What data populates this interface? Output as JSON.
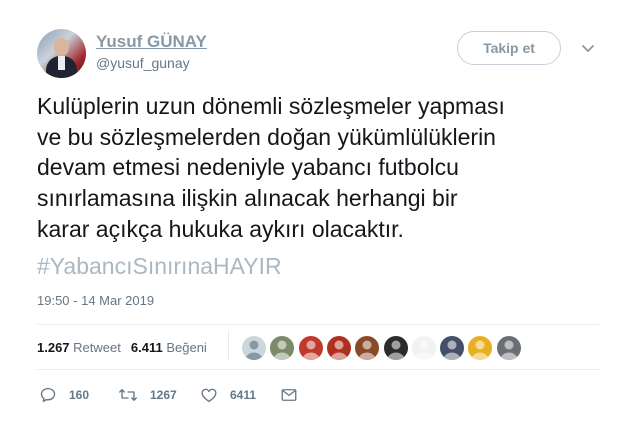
{
  "author": {
    "name": "Yusuf GÜNAY",
    "handle": "@yusuf_gunay"
  },
  "follow_label": "Takip et",
  "tweet": {
    "lines": [
      "Kulüplerin uzun dönemli sözleşmeler yapması",
      "ve bu sözleşmelerden doğan yükümlülüklerin",
      "devam etmesi nedeniyle yabancı futbolcu",
      "sınırlamasına ilişkin alınacak herhangi bir",
      "karar açıkça hukuka aykırı olacaktır."
    ],
    "hashtag": "#YabancıSınırınaHAYIR",
    "timestamp": "19:50 - 14 Mar 2019"
  },
  "stats": {
    "retweets_count": "1.267",
    "retweets_label": "Retweet",
    "likes_count": "6.411",
    "likes_label": "Beğeni"
  },
  "likers": [
    {
      "icon": "default-avatar-icon",
      "color": "#ccd6dd"
    },
    {
      "icon": "user-avatar-icon",
      "color": "#7a8a6a"
    },
    {
      "icon": "user-avatar-icon",
      "color": "#c0392b"
    },
    {
      "icon": "user-avatar-icon",
      "color": "#b03020"
    },
    {
      "icon": "user-avatar-icon",
      "color": "#8a4a2a"
    },
    {
      "icon": "user-avatar-icon",
      "color": "#2b2b2b"
    },
    {
      "icon": "user-avatar-icon",
      "color": "#f2f2f2"
    },
    {
      "icon": "user-avatar-icon",
      "color": "#44506a"
    },
    {
      "icon": "user-avatar-icon",
      "color": "#e8b020"
    },
    {
      "icon": "user-avatar-icon",
      "color": "#6b6f75"
    }
  ],
  "actions": {
    "replies": "160",
    "retweets": "1267",
    "likes": "6411"
  },
  "colors": {
    "text": "#14171a",
    "muted": "#657786",
    "hashtag": "#aab8c2",
    "name": "#8899a6",
    "divider": "#e6ecf0"
  }
}
